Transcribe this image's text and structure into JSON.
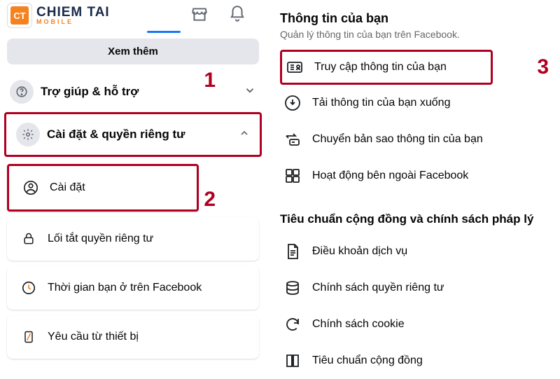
{
  "logo": {
    "badge": "CT",
    "line1": "CHIEM TAI",
    "line2": "MOBILE"
  },
  "left": {
    "see_more": "Xem thêm",
    "help": "Trợ giúp & hỗ trợ",
    "settings_privacy": "Cài đặt & quyền riêng tư",
    "settings": "Cài đặt",
    "privacy_shortcut": "Lối tắt quyền riêng tư",
    "time_on_fb": "Thời gian bạn ở trên Facebook",
    "device_requests": "Yêu cầu từ thiết bị"
  },
  "markers": {
    "m1": "1",
    "m2": "2",
    "m3": "3"
  },
  "right": {
    "title": "Thông tin của bạn",
    "subtitle": "Quản lý thông tin của bạn trên Facebook.",
    "access_info": "Truy cập thông tin của bạn",
    "download_info": "Tải thông tin của bạn xuống",
    "transfer_copy": "Chuyển bản sao thông tin của bạn",
    "off_fb_activity": "Hoạt động bên ngoài Facebook",
    "section2_title": "Tiêu chuẩn cộng đồng và chính sách pháp lý",
    "tos": "Điều khoản dịch vụ",
    "privacy_policy": "Chính sách quyền riêng tư",
    "cookie_policy": "Chính sách cookie",
    "community_standards": "Tiêu chuẩn cộng đồng"
  }
}
